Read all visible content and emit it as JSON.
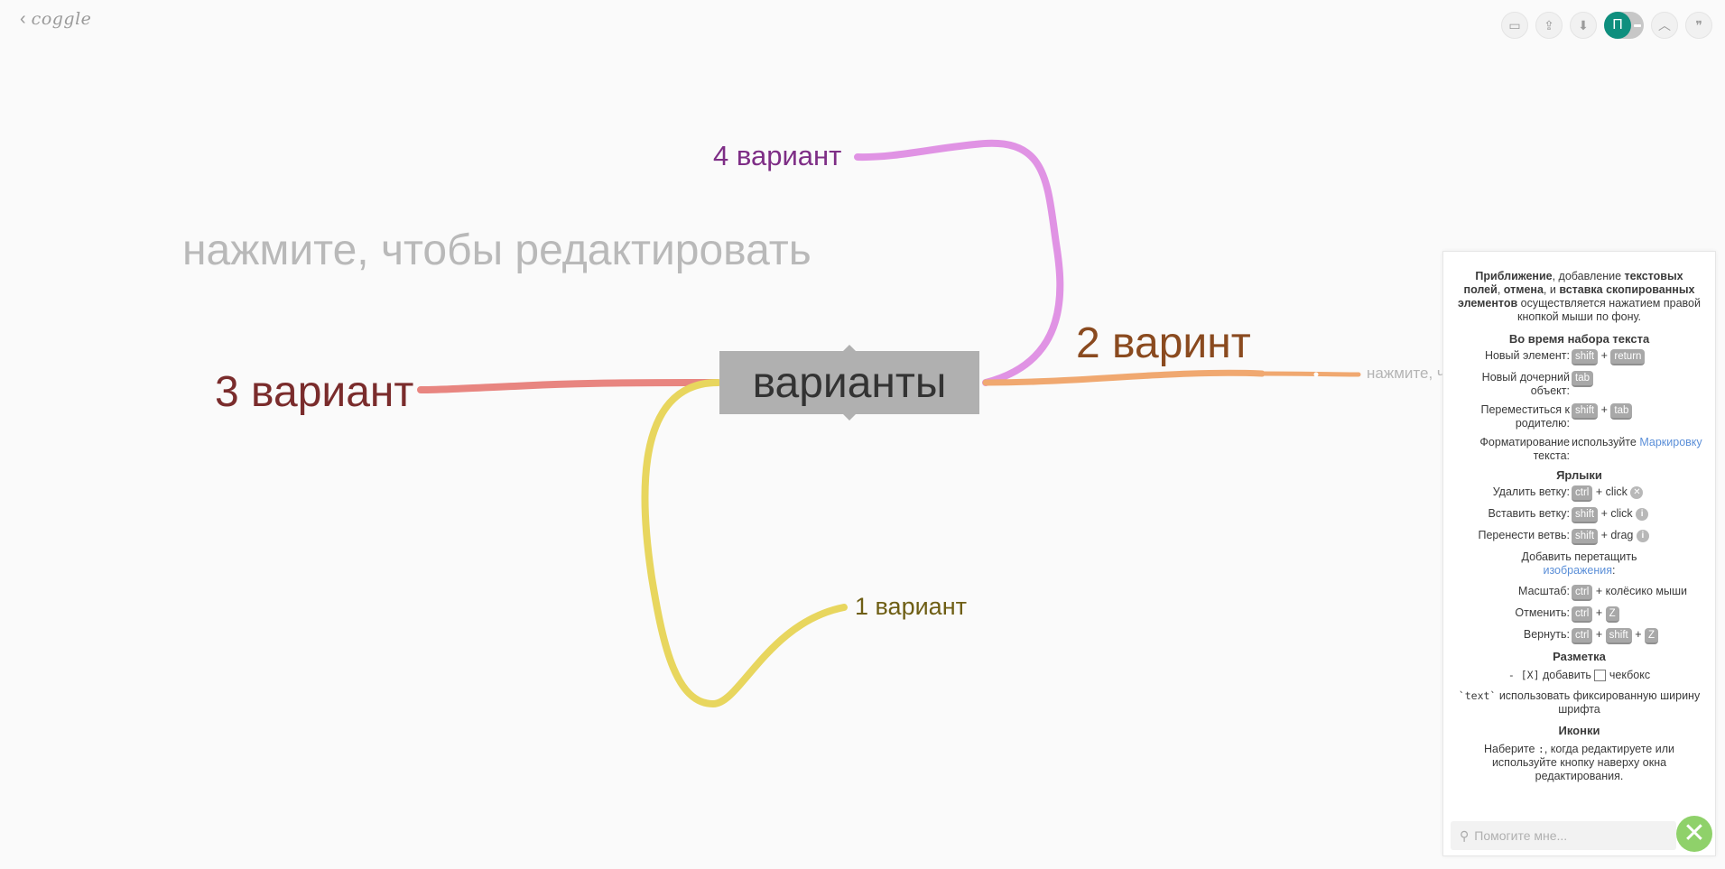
{
  "app": {
    "logo_text": "coggle",
    "back_glyph": "‹"
  },
  "toolbar": {
    "buttons": [
      {
        "name": "present-icon",
        "glyph": "▭"
      },
      {
        "name": "share-icon",
        "glyph": "⇪"
      },
      {
        "name": "download-icon",
        "glyph": "⬇"
      }
    ],
    "avatar_initial": "П",
    "extra_buttons": [
      {
        "name": "collapse-icon",
        "glyph": "︿"
      },
      {
        "name": "quote-icon",
        "glyph": "❞"
      }
    ]
  },
  "map": {
    "edit_hint": "нажмите, чтобы редактировать",
    "center": "варианты",
    "branches": {
      "v4": "4 вариант",
      "v2": "2 варинт",
      "v3": "3 вариант",
      "v1": "1 вариант"
    },
    "sub_hint": "нажмите, ч",
    "colors": {
      "v4": "#e093e4",
      "v2": "#f0a870",
      "v3": "#e88580",
      "v1": "#e8d65e",
      "center": "#b0b0b0"
    }
  },
  "help": {
    "intro_b1": "Приближение",
    "intro_t1": ", добавление ",
    "intro_b2": "текстовых полей",
    "intro_t2": ", ",
    "intro_b3": "отмена",
    "intro_t3": ", и ",
    "intro_b4": "вставка скопированных элементов",
    "intro_t4": " осуществляется нажатием правой кнопкой мыши по фону.",
    "typing_heading": "Во время набора текста",
    "new_element_label": "Новый элемент:",
    "new_child_label": "Новый дочерний объект:",
    "move_parent_label": "Переместиться к родителю:",
    "format_label": "Форматирование текста:",
    "format_use": "используйте ",
    "format_link": "Маркировку",
    "shortcuts_heading": "Ярлыки",
    "delete_label": "Удалить ветку:",
    "insert_label": "Вставить ветку:",
    "move_branch_label": "Перенести ветвь:",
    "add_image_text": "Добавить перетащить",
    "add_image_link": "изображения",
    "add_image_colon": ":",
    "zoom_label": "Масштаб:",
    "zoom_text": "+ колёсико мыши",
    "undo_label": "Отменить:",
    "redo_label": "Вернуть:",
    "click_text": "+ click",
    "drag_text": "+ drag",
    "plus": "+",
    "keys": {
      "shift": "shift",
      "return": "return",
      "tab": "tab",
      "ctrl": "ctrl",
      "z": "Z"
    },
    "markup_heading": "Разметка",
    "markup_checkbox_code": "- [X]",
    "markup_checkbox_text": " добавить ",
    "markup_checkbox_after": " чекбокс",
    "markup_mono_code": "`text`",
    "markup_mono_text": " использовать фиксированную ширину шрифта",
    "icons_heading": "Иконки",
    "icons_text_1": "Наберите ",
    "icons_code": ":",
    "icons_text_2": ", когда редактируете или используйте кнопку наверху окна редактирования.",
    "search_placeholder": "Помогите мне...",
    "close_glyph": "✕"
  }
}
